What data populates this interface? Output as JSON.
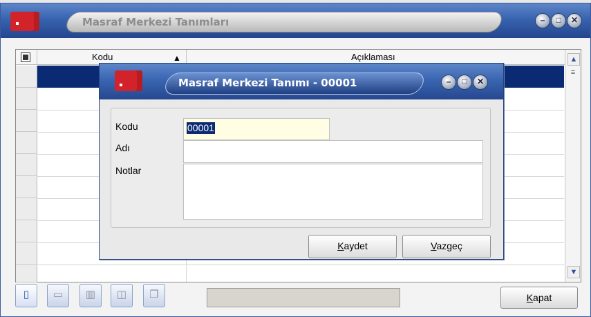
{
  "outer_window": {
    "title": "Masraf Merkezi Tanımları",
    "controls": {
      "minimize": "–",
      "maximize": "□",
      "close": "✕"
    }
  },
  "grid": {
    "columns": [
      {
        "label": "Kodu",
        "sort": "ascending",
        "sort_glyph": "▲"
      },
      {
        "label": "Açıklaması"
      }
    ],
    "selected_row": 1,
    "scroll_up": "▲",
    "scroll_down": "▼",
    "scroll_thumb": "≡"
  },
  "toolbar": {
    "icons": [
      "new-document-icon",
      "open-folder-icon",
      "delete-trash-icon",
      "preview-icon",
      "copy-icon"
    ],
    "status_text": "",
    "close_button": {
      "label_underlined": "K",
      "label_rest": "apat"
    }
  },
  "dialog": {
    "title": "Masraf Merkezi Tanımı - 00001",
    "controls": {
      "minimize": "–",
      "maximize": "□",
      "close": "✕"
    },
    "fields": {
      "kodu": {
        "label": "Kodu",
        "value": "00001"
      },
      "adi": {
        "label": "Adı",
        "value": ""
      },
      "notlar": {
        "label": "Notlar",
        "value": ""
      }
    },
    "buttons": {
      "save": {
        "label_underlined": "K",
        "label_rest": "aydet"
      },
      "cancel": {
        "label_underlined": "V",
        "label_rest": "azgeç"
      }
    }
  },
  "colors": {
    "title_bar": "#3863b0",
    "selection": "#0a2a73",
    "logo_red": "#d2232a",
    "code_field_bg": "#fffee4"
  }
}
